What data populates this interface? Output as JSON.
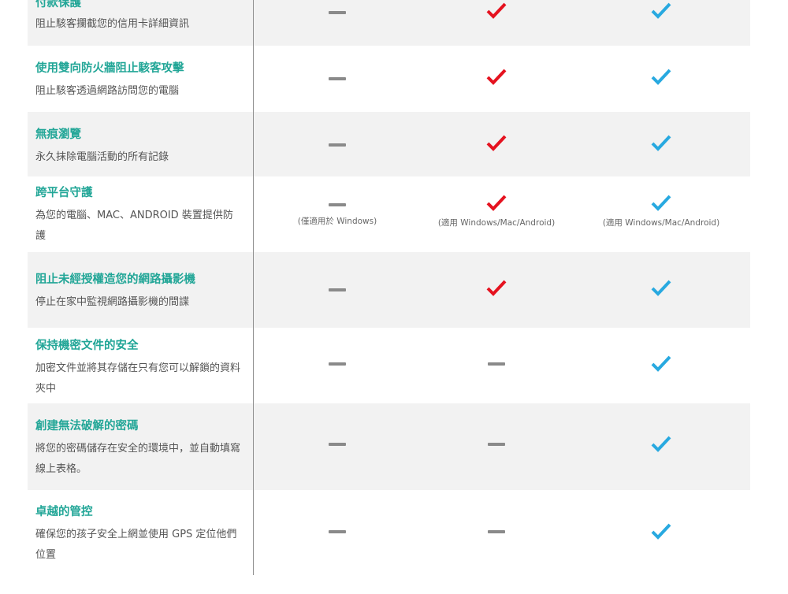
{
  "colors": {
    "title": "#22a697",
    "red_check": "#e5121f",
    "blue_check": "#28a9e0",
    "dash": "#8a8a8a",
    "row_shade": "#f2f2f2"
  },
  "rows": [
    {
      "title": "付款保護",
      "desc": "阻止駭客攔截您的信用卡詳細資訊",
      "col1": "—",
      "col2": "✔",
      "col3": "✔"
    },
    {
      "title": "使用雙向防火牆阻止駭客攻擊",
      "desc": "阻止駭客透過網路訪問您的電腦",
      "col1": "—",
      "col2": "✔",
      "col3": "✔"
    },
    {
      "title": "無痕瀏覽",
      "desc": "永久抹除電腦活動的所有記錄",
      "col1": "—",
      "col2": "✔",
      "col3": "✔"
    },
    {
      "title": "跨平台守護",
      "desc": "為您的電腦、MAC、ANDROID 裝置提供防護",
      "col1": "—",
      "col2": "✔",
      "col3": "✔",
      "col1_note": "(僅適用於 Windows)",
      "col2_note": "(適用 Windows/Mac/Android)",
      "col3_note": "(適用 Windows/Mac/Android)"
    },
    {
      "title": "阻止未經授權造您的網路攝影機",
      "desc": "停止在家中監視網路攝影機的間諜",
      "col1": "—",
      "col2": "✔",
      "col3": "✔"
    },
    {
      "title": "保持機密文件的安全",
      "desc": "加密文件並將其存儲在只有您可以解鎖的資料夾中",
      "col1": "—",
      "col2": "—",
      "col3": "✔"
    },
    {
      "title": "創建無法破解的密碼",
      "desc": "將您的密碼儲存在安全的環境中，並自動填寫線上表格。",
      "col1": "—",
      "col2": "—",
      "col3": "✔"
    },
    {
      "title": "卓越的管控",
      "desc": "確保您的孩子安全上網並使用 GPS 定位他們位置",
      "col1": "—",
      "col2": "—",
      "col3": "✔"
    }
  ]
}
